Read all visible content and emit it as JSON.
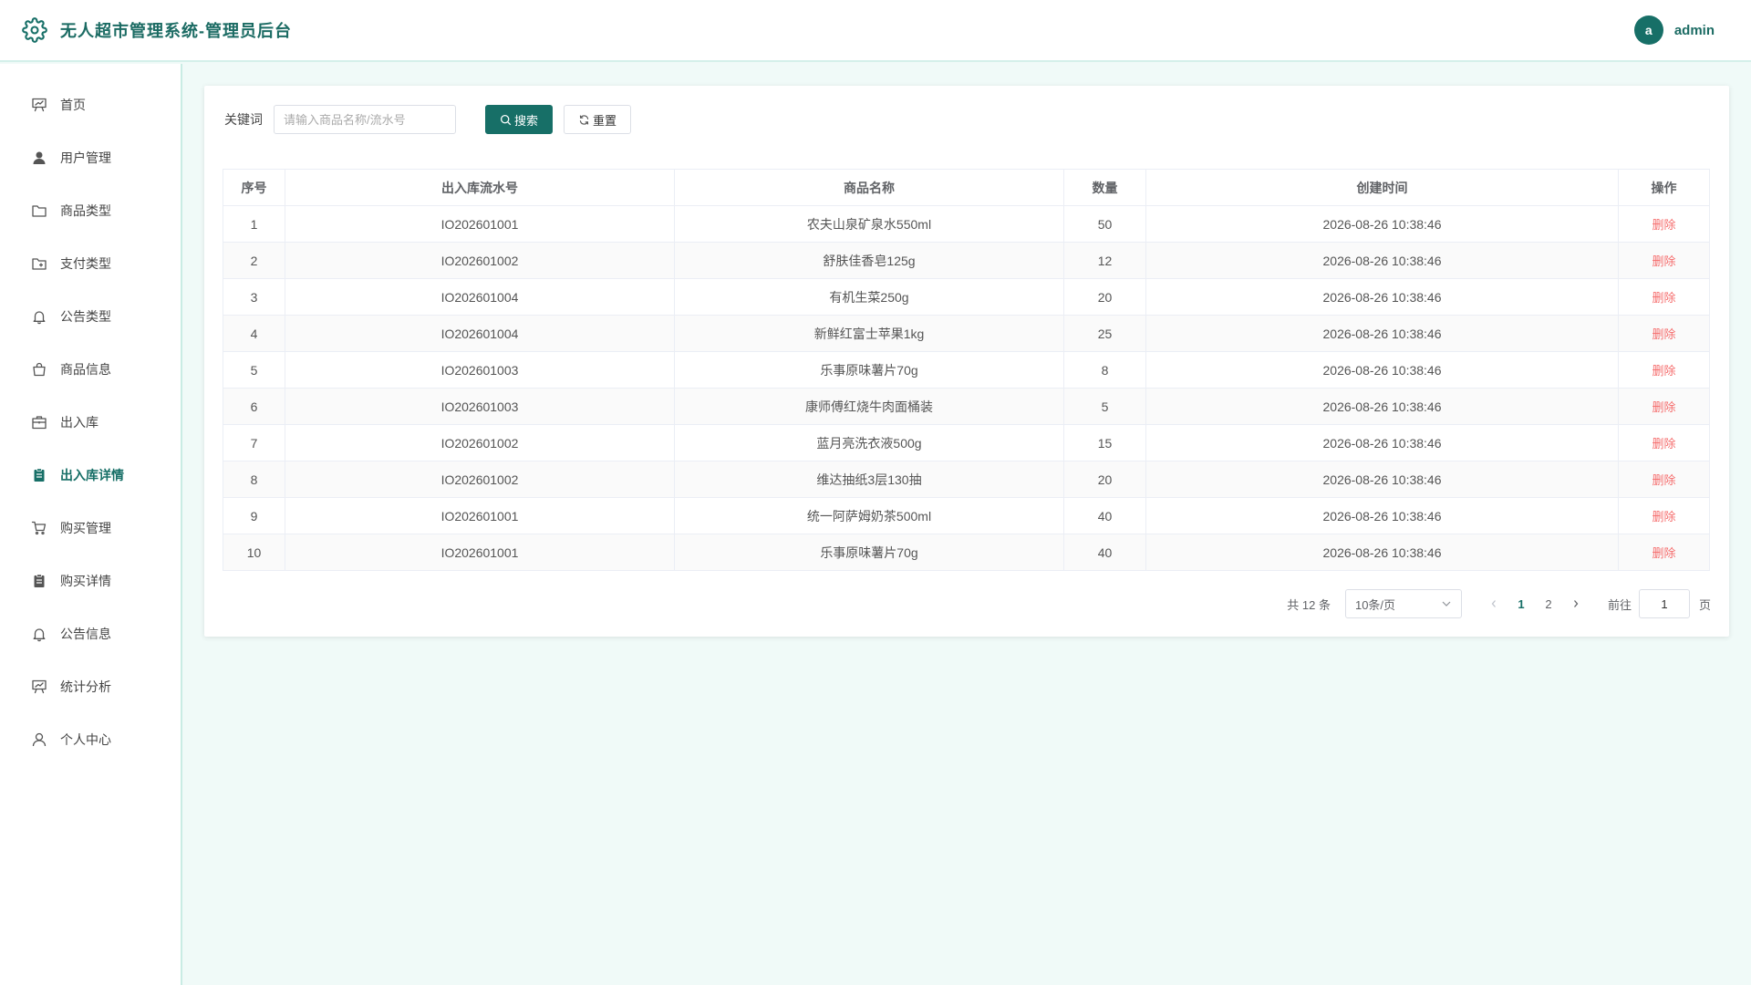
{
  "header": {
    "title": "无人超市管理系统-管理员后台",
    "avatar_letter": "a",
    "username": "admin"
  },
  "colors": {
    "brand": "#176f67",
    "danger": "#f56c6c",
    "page_bg": "#f0faf8"
  },
  "sidebar": {
    "items": [
      {
        "label": "首页",
        "icon": "presentation-board-icon",
        "active": false
      },
      {
        "label": "用户管理",
        "icon": "user-icon",
        "active": false
      },
      {
        "label": "商品类型",
        "icon": "folder-icon",
        "active": false
      },
      {
        "label": "支付类型",
        "icon": "folder-add-icon",
        "active": false
      },
      {
        "label": "公告类型",
        "icon": "bell-icon",
        "active": false
      },
      {
        "label": "商品信息",
        "icon": "shopping-bag-icon",
        "active": false
      },
      {
        "label": "出入库",
        "icon": "briefcase-icon",
        "active": false
      },
      {
        "label": "出入库详情",
        "icon": "clipboard-icon",
        "active": true
      },
      {
        "label": "购买管理",
        "icon": "shopping-cart-icon",
        "active": false
      },
      {
        "label": "购买详情",
        "icon": "clipboard-icon",
        "active": false
      },
      {
        "label": "公告信息",
        "icon": "bell-icon",
        "active": false
      },
      {
        "label": "统计分析",
        "icon": "presentation-board-icon",
        "active": false
      },
      {
        "label": "个人中心",
        "icon": "user-outline-icon",
        "active": false
      }
    ]
  },
  "search": {
    "label": "关键词",
    "placeholder": "请输入商品名称/流水号",
    "value": "",
    "search_label": "搜索",
    "reset_label": "重置"
  },
  "table": {
    "columns": [
      "序号",
      "出入库流水号",
      "商品名称",
      "数量",
      "创建时间",
      "操作"
    ],
    "delete_label": "删除",
    "rows": [
      {
        "index": "1",
        "serial": "IO202601001",
        "product": "农夫山泉矿泉水550ml",
        "qty": "50",
        "created": "2026-08-26 10:38:46"
      },
      {
        "index": "2",
        "serial": "IO202601002",
        "product": "舒肤佳香皂125g",
        "qty": "12",
        "created": "2026-08-26 10:38:46"
      },
      {
        "index": "3",
        "serial": "IO202601004",
        "product": "有机生菜250g",
        "qty": "20",
        "created": "2026-08-26 10:38:46"
      },
      {
        "index": "4",
        "serial": "IO202601004",
        "product": "新鲜红富士苹果1kg",
        "qty": "25",
        "created": "2026-08-26 10:38:46"
      },
      {
        "index": "5",
        "serial": "IO202601003",
        "product": "乐事原味薯片70g",
        "qty": "8",
        "created": "2026-08-26 10:38:46"
      },
      {
        "index": "6",
        "serial": "IO202601003",
        "product": "康师傅红烧牛肉面桶装",
        "qty": "5",
        "created": "2026-08-26 10:38:46"
      },
      {
        "index": "7",
        "serial": "IO202601002",
        "product": "蓝月亮洗衣液500g",
        "qty": "15",
        "created": "2026-08-26 10:38:46"
      },
      {
        "index": "8",
        "serial": "IO202601002",
        "product": "维达抽纸3层130抽",
        "qty": "20",
        "created": "2026-08-26 10:38:46"
      },
      {
        "index": "9",
        "serial": "IO202601001",
        "product": "统一阿萨姆奶茶500ml",
        "qty": "40",
        "created": "2026-08-26 10:38:46"
      },
      {
        "index": "10",
        "serial": "IO202601001",
        "product": "乐事原味薯片70g",
        "qty": "40",
        "created": "2026-08-26 10:38:46"
      }
    ]
  },
  "pagination": {
    "total_text": "共 12 条",
    "page_size": "10条/页",
    "pages": [
      "1",
      "2"
    ],
    "current_page": "1",
    "goto_label": "前往",
    "goto_value": "1",
    "page_unit": "页"
  }
}
